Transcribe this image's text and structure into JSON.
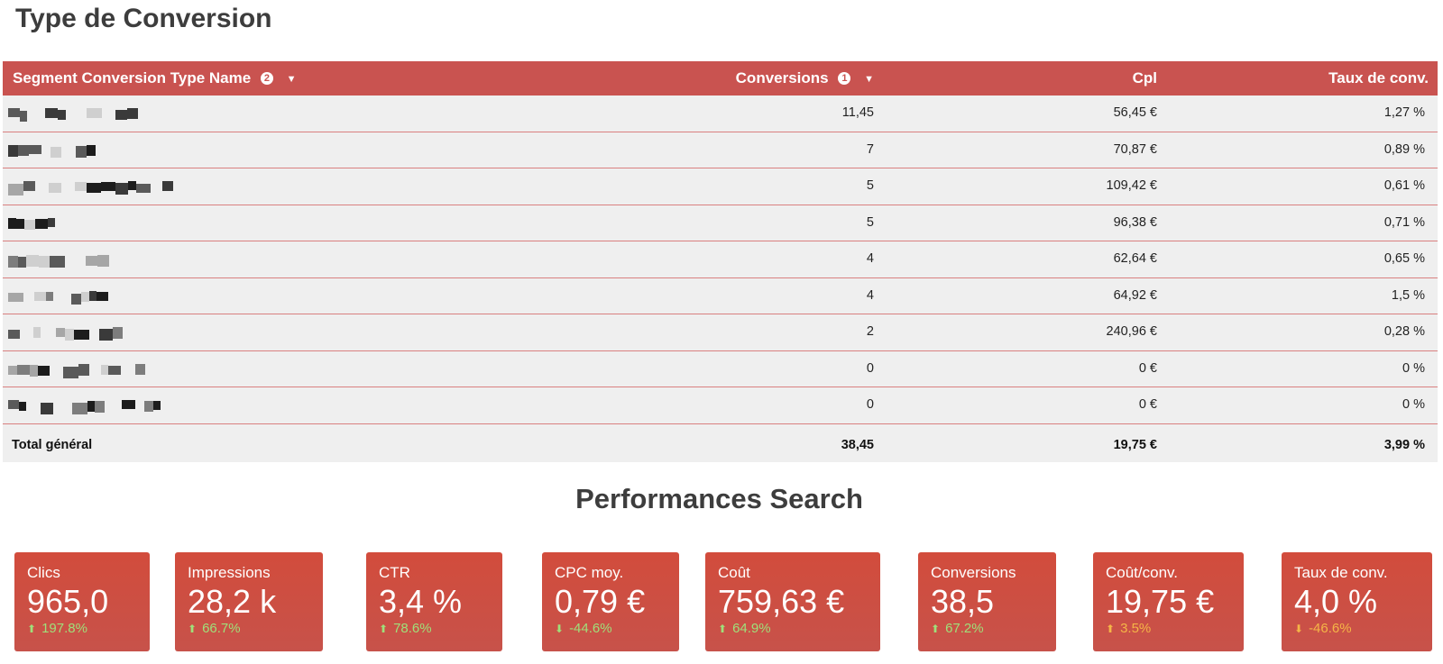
{
  "conversion_section": {
    "title": "Type de Conversion",
    "columns": {
      "name": "Segment Conversion Type Name",
      "name_badge": "2",
      "conversions": "Conversions",
      "conversions_badge": "1",
      "cpl": "Cpl",
      "rate": "Taux de conv."
    },
    "rows": [
      {
        "conversions": "11,45",
        "cpl": "56,45 €",
        "rate": "1,27 %"
      },
      {
        "conversions": "7",
        "cpl": "70,87 €",
        "rate": "0,89 %"
      },
      {
        "conversions": "5",
        "cpl": "109,42 €",
        "rate": "0,61 %"
      },
      {
        "conversions": "5",
        "cpl": "96,38 €",
        "rate": "0,71 %"
      },
      {
        "conversions": "4",
        "cpl": "62,64 €",
        "rate": "0,65 %"
      },
      {
        "conversions": "4",
        "cpl": "64,92 €",
        "rate": "1,5 %"
      },
      {
        "conversions": "2",
        "cpl": "240,96 €",
        "rate": "0,28 %"
      },
      {
        "conversions": "0",
        "cpl": "0 €",
        "rate": "0 %"
      },
      {
        "conversions": "0",
        "cpl": "0 €",
        "rate": "0 %"
      }
    ],
    "total": {
      "label": "Total général",
      "conversions": "38,45",
      "cpl": "19,75 €",
      "rate": "3,99 %"
    }
  },
  "performance_section": {
    "title": "Performances Search",
    "cards": [
      {
        "label": "Clics",
        "value": "965,0",
        "delta": "197.8%",
        "direction": "up",
        "delta_color": "#9fe07a"
      },
      {
        "label": "Impressions",
        "value": "28,2 k",
        "delta": "66.7%",
        "direction": "up",
        "delta_color": "#9fe07a"
      },
      {
        "label": "CTR",
        "value": "3,4 %",
        "delta": "78.6%",
        "direction": "up",
        "delta_color": "#9fe07a"
      },
      {
        "label": "CPC moy.",
        "value": "0,79 €",
        "delta": "-44.6%",
        "direction": "down",
        "delta_color": "#9fe07a"
      },
      {
        "label": "Coût",
        "value": "759,63 €",
        "delta": "64.9%",
        "direction": "up",
        "delta_color": "#9fe07a"
      },
      {
        "label": "Conversions",
        "value": "38,5",
        "delta": "67.2%",
        "direction": "up",
        "delta_color": "#9fe07a"
      },
      {
        "label": "Coût/conv.",
        "value": "19,75 €",
        "delta": "3.5%",
        "direction": "up",
        "delta_color": "#f5b547"
      },
      {
        "label": "Taux de conv.",
        "value": "4,0 %",
        "delta": "-46.6%",
        "direction": "down",
        "delta_color": "#f5b547"
      }
    ]
  },
  "colors": {
    "header_red": "#c95350",
    "card_red": "#d24c3c",
    "row_background": "#efefef",
    "positive_delta": "#9fe07a",
    "warning_delta": "#f5b547"
  }
}
